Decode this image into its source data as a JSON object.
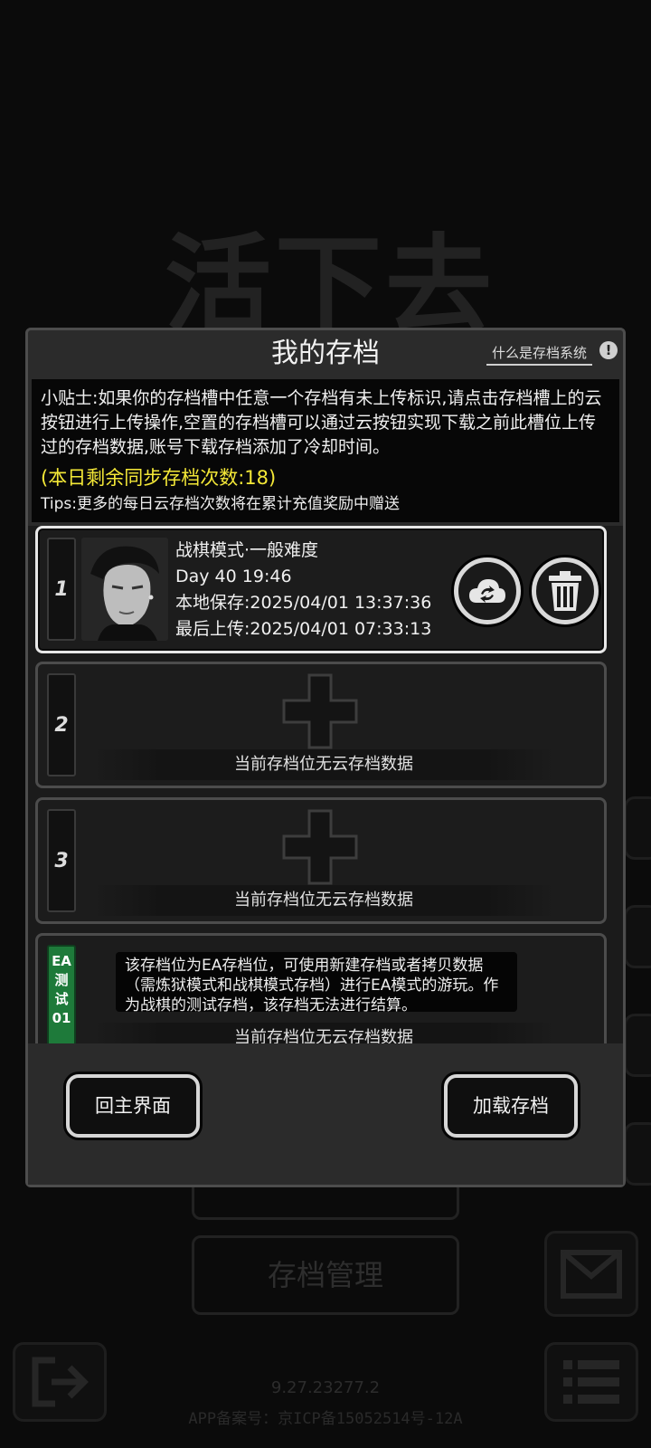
{
  "background": {
    "title": "活下去",
    "manage_button": "存档管理",
    "version": "9.27.23277.2",
    "icp": "APP备案号：京ICP备15052514号-12A"
  },
  "dialog": {
    "title": "我的存档",
    "help_link": "什么是存档系统",
    "help_icon": "!",
    "tips": {
      "main": "小贴士:如果你的存档槽中任意一个存档有未上传标识,请点击存档槽上的云按钮进行上传操作,空置的存档槽可以通过云按钮实现下载之前此槽位上传过的存档数据,账号下载存档添加了冷却时间。",
      "remaining": "(本日剩余同步存档次数:18)",
      "more": "Tips:更多的每日云存档次数将在累计充值奖励中赠送"
    },
    "slots": [
      {
        "number": "1",
        "mode": "战棋模式·一般难度",
        "day": "Day 40  19:46",
        "local_save": "本地保存:2025/04/01  13:37:36",
        "last_upload": "最后上传:2025/04/01  07:33:13",
        "cloud_icon": "cloud-sync-icon",
        "trash_icon": "trash-icon"
      },
      {
        "number": "2",
        "empty_text": "当前存档位无云存档数据"
      },
      {
        "number": "3",
        "empty_text": "当前存档位无云存档数据"
      },
      {
        "badge": [
          "EA",
          "测",
          "试",
          "01"
        ],
        "note": "该存档位为EA存档位，可使用新建存档或者拷贝数据（需炼狱模式和战棋模式存档）进行EA模式的游玩。作为战棋的测试存档，该存档无法进行结算。",
        "empty_text": "当前存档位无云存档数据"
      }
    ],
    "buttons": {
      "home": "回主界面",
      "load": "加载存档"
    }
  },
  "colors": {
    "accent_yellow": "#f4e837",
    "ea_green": "#1e7a3a",
    "panel": "#2b2b2b"
  }
}
